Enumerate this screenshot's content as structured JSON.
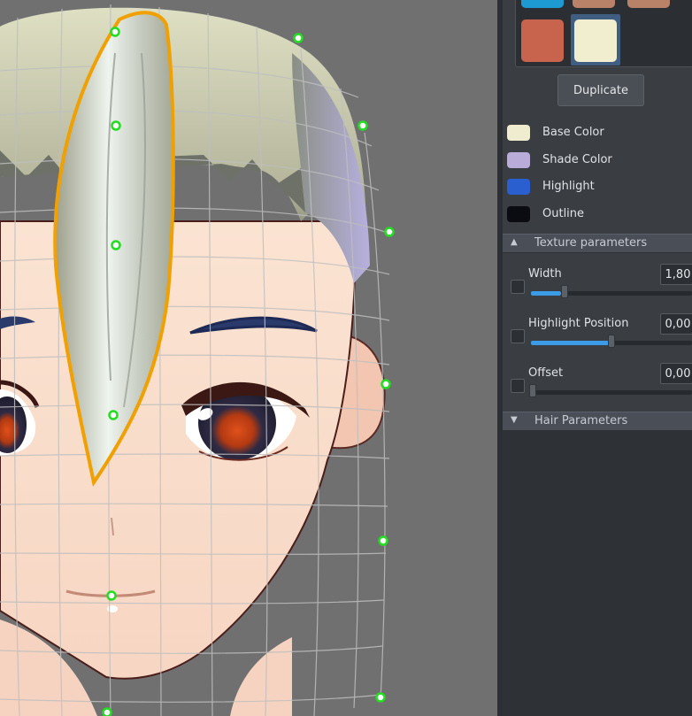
{
  "viewport": {
    "label": "3D head model viewport with hair strand selected"
  },
  "swatches": [
    {
      "color": "#1e9ad3"
    },
    {
      "color": "#b78268"
    },
    {
      "color": "#b78268"
    },
    {
      "color": "#c8634e"
    },
    {
      "color": "#f1edcf"
    }
  ],
  "duplicate_label": "Duplicate",
  "colors": [
    {
      "label": "Base Color",
      "color": "#f0ecd0",
      "icon": "base-color-swatch"
    },
    {
      "label": "Shade Color",
      "color": "#b9acd8",
      "icon": "shade-color-swatch"
    },
    {
      "label": "Highlight",
      "color": "#2a5fcf",
      "icon": "highlight-color-swatch"
    },
    {
      "label": "Outline",
      "color": "#0b0b12",
      "icon": "outline-color-swatch"
    }
  ],
  "texture_section": {
    "title": "Texture parameters",
    "expanded": true
  },
  "params": [
    {
      "label": "Width",
      "value": "1,80",
      "level": 0.2
    },
    {
      "label": "Highlight Position",
      "value": "0,00",
      "level": 0.5
    },
    {
      "label": "Offset",
      "value": "0,00",
      "level": 0.0
    }
  ],
  "hair_section": {
    "title": "Hair Parameters",
    "expanded": false
  },
  "accent": "#3b9be6",
  "selection_color": "#f0a000"
}
